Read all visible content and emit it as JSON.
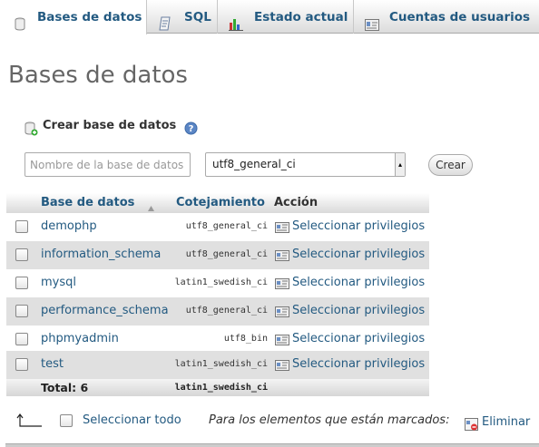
{
  "tabs": [
    {
      "label": "Bases de datos",
      "icon": "database-icon",
      "active": true
    },
    {
      "label": "SQL",
      "icon": "sql-icon",
      "active": false
    },
    {
      "label": "Estado actual",
      "icon": "status-chart-icon",
      "active": false
    },
    {
      "label": "Cuentas de usuarios",
      "icon": "user-accounts-icon",
      "active": false
    }
  ],
  "page": {
    "title": "Bases de datos"
  },
  "create": {
    "label": "Crear base de datos",
    "placeholder": "Nombre de la base de datos",
    "collation": "utf8_general_ci",
    "button": "Crear"
  },
  "table": {
    "headers": {
      "database": "Base de datos",
      "collation": "Cotejamiento",
      "action": "Acción"
    },
    "rows": [
      {
        "name": "demophp",
        "collation": "utf8_general_ci",
        "action": "Seleccionar privilegios"
      },
      {
        "name": "information_schema",
        "collation": "utf8_general_ci",
        "action": "Seleccionar privilegios"
      },
      {
        "name": "mysql",
        "collation": "latin1_swedish_ci",
        "action": "Seleccionar privilegios"
      },
      {
        "name": "performance_schema",
        "collation": "utf8_general_ci",
        "action": "Seleccionar privilegios"
      },
      {
        "name": "phpmyadmin",
        "collation": "utf8_bin",
        "action": "Seleccionar privilegios"
      },
      {
        "name": "test",
        "collation": "latin1_swedish_ci",
        "action": "Seleccionar privilegios"
      }
    ],
    "total": {
      "label": "Total: 6",
      "collation": "latin1_swedish_ci"
    }
  },
  "footer": {
    "select_all": "Seleccionar todo",
    "marked": "Para los elementos que están marcados:",
    "delete": "Eliminar"
  },
  "colors": {
    "link": "#235a81",
    "row_alt": "#e0e0e0"
  }
}
